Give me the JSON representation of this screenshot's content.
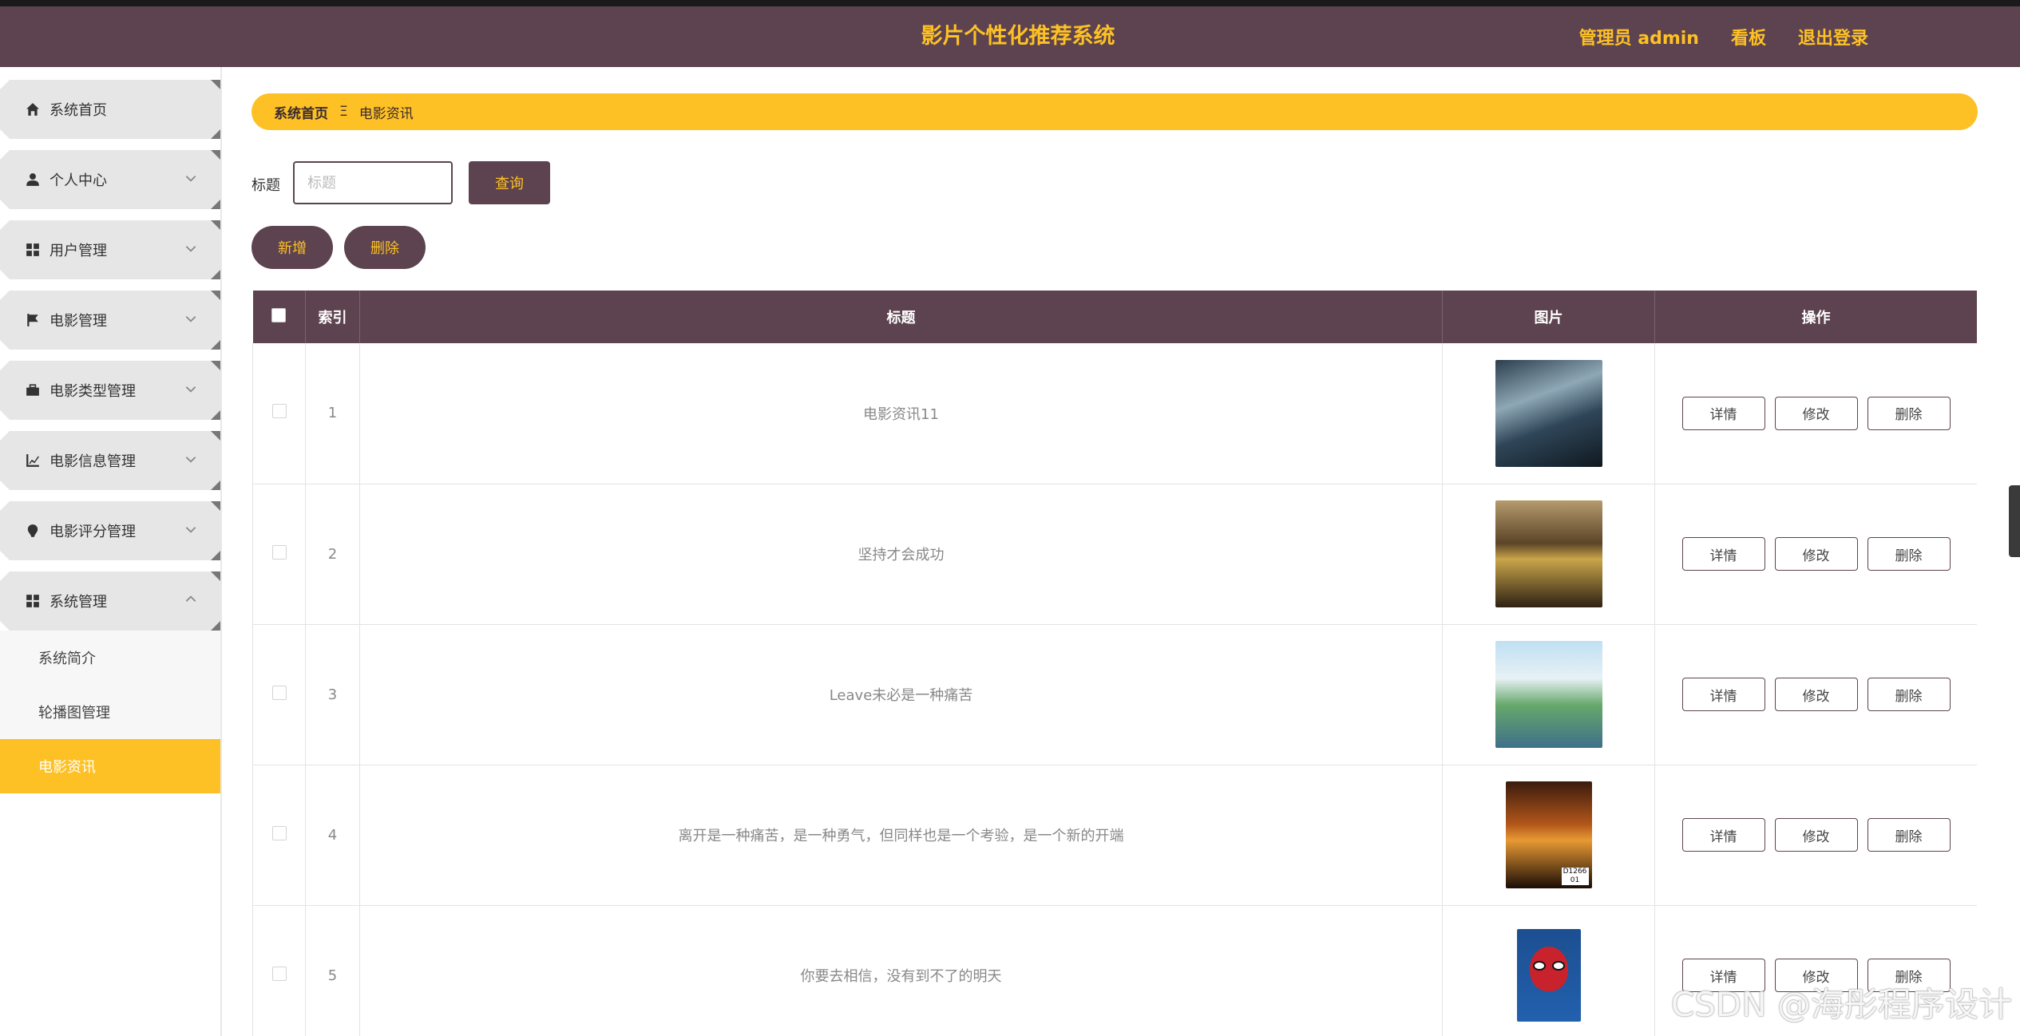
{
  "header": {
    "app_title": "影片个性化推荐系统",
    "admin_label": "管理员 admin",
    "board_label": "看板",
    "logout_label": "退出登录",
    "bg_color": "#5d434f",
    "accent_color": "#fdc125"
  },
  "sidebar": {
    "items": [
      {
        "label": "系统首页",
        "icon": "home-icon"
      },
      {
        "label": "个人中心",
        "icon": "user-icon"
      },
      {
        "label": "用户管理",
        "icon": "grid-icon"
      },
      {
        "label": "电影管理",
        "icon": "flag-icon"
      },
      {
        "label": "电影类型管理",
        "icon": "briefcase-icon"
      },
      {
        "label": "电影信息管理",
        "icon": "chart-icon"
      },
      {
        "label": "电影评分管理",
        "icon": "pin-icon"
      },
      {
        "label": "系统管理",
        "icon": "grid-icon"
      }
    ],
    "sub_items": [
      {
        "label": "系统简介"
      },
      {
        "label": "轮播图管理"
      },
      {
        "label": "电影资讯"
      }
    ]
  },
  "breadcrumb": {
    "home": "系统首页",
    "separator": "Ξ",
    "current": "电影资讯"
  },
  "search": {
    "label": "标题",
    "placeholder": "标题",
    "query_label": "查询"
  },
  "actions": {
    "add_label": "新增",
    "delete_label": "删除"
  },
  "table": {
    "headers": [
      "索引",
      "标题",
      "图片",
      "操作"
    ],
    "rows": [
      {
        "index": "1",
        "title": "电影资讯11"
      },
      {
        "index": "2",
        "title": "坚持才会成功"
      },
      {
        "index": "3",
        "title": "Leave未必是一种痛苦"
      },
      {
        "index": "4",
        "title": "离开是一种痛苦，是一种勇气，但同样也是一个考验，是一个新的开端"
      },
      {
        "index": "5",
        "title": "你要去相信，没有到不了的明天"
      }
    ],
    "row_actions": {
      "detail": "详情",
      "edit": "修改",
      "delete": "删除"
    }
  },
  "poster_texts": {
    "row4_code": "D1266 01"
  },
  "watermark": "CSDN @海彤程序设计"
}
